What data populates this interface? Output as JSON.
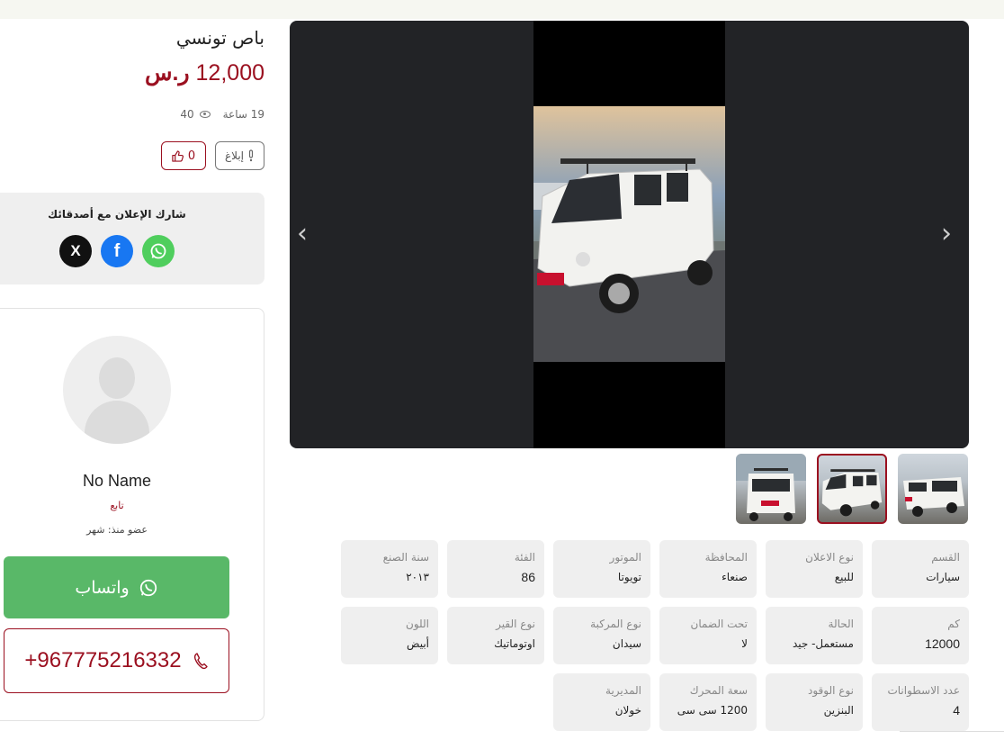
{
  "listing": {
    "title": "باص تونسي",
    "price_value": "12,000",
    "price_currency": "ر.س",
    "time_ago": "19 ساعة",
    "views": "40",
    "report_label": "إبلاغ",
    "likes": "0"
  },
  "share": {
    "title": "شارك الإعلان مع أصدقائك",
    "x_glyph": "X",
    "facebook_glyph": "f",
    "icons": [
      "x-icon",
      "facebook-icon",
      "whatsapp-icon"
    ]
  },
  "seller": {
    "name": "No Name",
    "role": "تابع",
    "member_since": "عضو منذ: شهر",
    "whatsapp_label": "واتساب",
    "phone": "+967775216332"
  },
  "gallery": {
    "prev": "‹",
    "next": "›"
  },
  "specs": [
    {
      "label": "القسم",
      "value": "سيارات"
    },
    {
      "label": "نوع الاعلان",
      "value": "للبيع"
    },
    {
      "label": "المحافظة",
      "value": "صنعاء"
    },
    {
      "label": "الموتور",
      "value": "تويوتا"
    },
    {
      "label": "الفئة",
      "value": "86"
    },
    {
      "label": "سنة الصنع",
      "value": "٢٠١٣"
    },
    {
      "label": "كم",
      "value": "12000"
    },
    {
      "label": "الحالة",
      "value": "مستعمل- جيد"
    },
    {
      "label": "تحت الضمان",
      "value": "لا"
    },
    {
      "label": "نوع المركبة",
      "value": "سيدان"
    },
    {
      "label": "نوع القير",
      "value": "اوتوماتيك"
    },
    {
      "label": "اللون",
      "value": "أبيض"
    },
    {
      "label": "عدد الاسطوانات",
      "value": "4"
    },
    {
      "label": "نوع الوقود",
      "value": "البنزين"
    },
    {
      "label": "سعة المحرك",
      "value": "1200 سى سى"
    },
    {
      "label": "المديرية",
      "value": "خولان"
    }
  ],
  "colors": {
    "accent": "#9b1020",
    "whatsapp_green": "#59b868",
    "gallery_bg": "#222326",
    "spec_bg": "#efefef"
  }
}
